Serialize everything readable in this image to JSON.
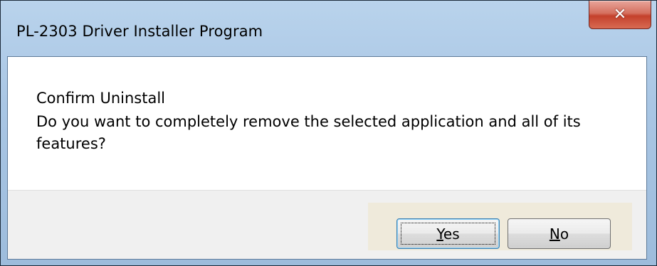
{
  "window": {
    "title": "PL-2303 Driver Installer Program",
    "close_icon": "close-icon",
    "close_glyph": "✕"
  },
  "message": {
    "line1": "Confirm Uninstall",
    "line2": "Do you want to completely remove the selected application and all of its",
    "line3": "features?"
  },
  "buttons": {
    "yes": {
      "mnemonic": "Y",
      "rest": "es",
      "is_default": true
    },
    "no": {
      "mnemonic": "N",
      "rest": "o",
      "is_default": false
    }
  },
  "colors": {
    "titlebar": "#a9c6e4",
    "close_button": "#c4412c",
    "button_panel": "#efeadb"
  }
}
